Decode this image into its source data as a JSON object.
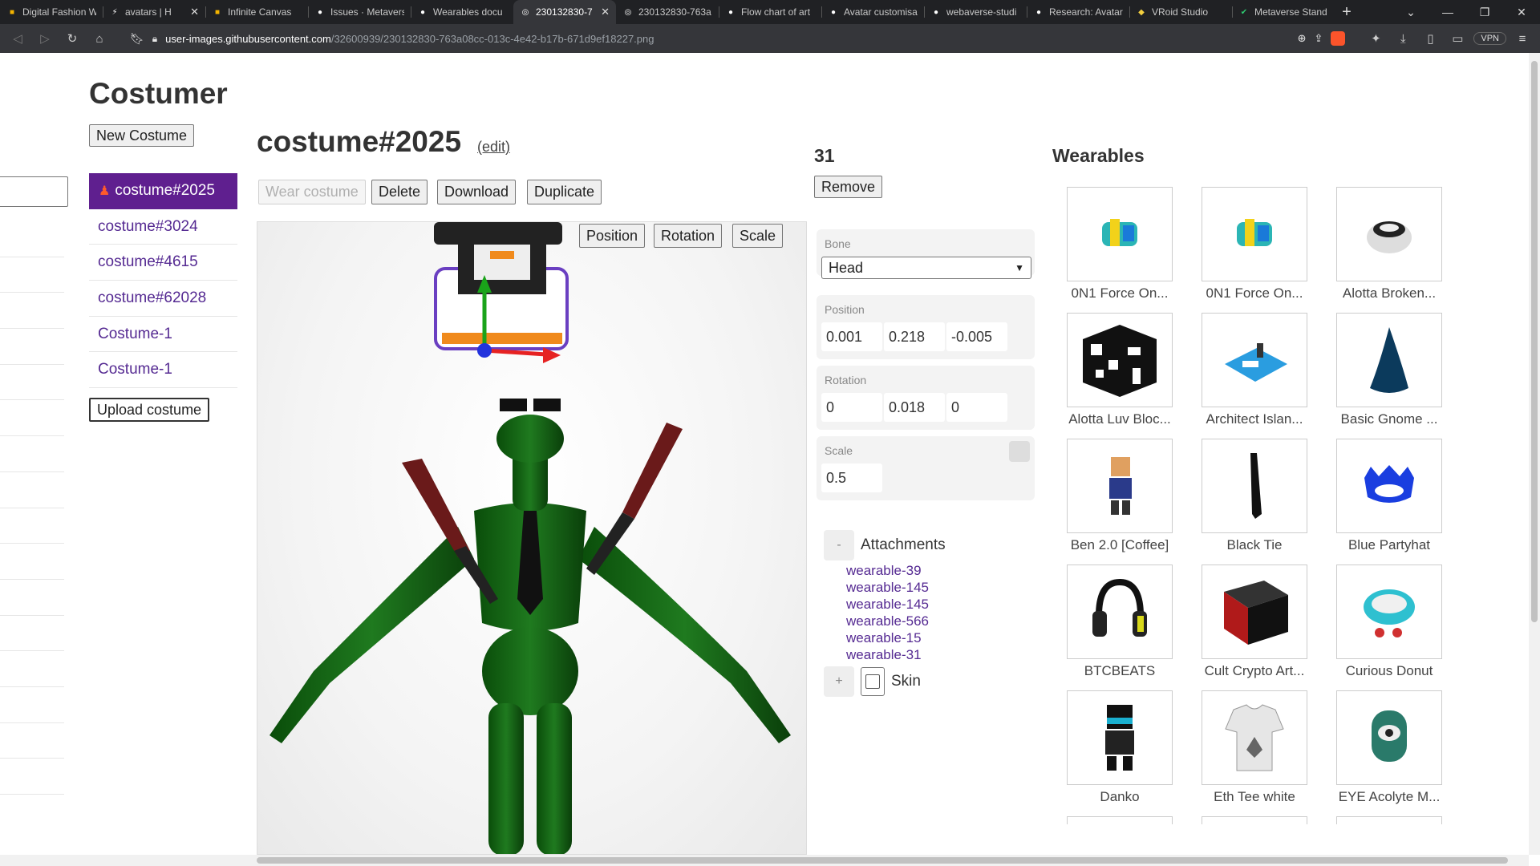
{
  "browser": {
    "tabs": [
      {
        "title": "Digital Fashion W",
        "icon": "page-icon",
        "color": "#f4b400",
        "active": false
      },
      {
        "title": "avatars | H",
        "icon": "audio-icon",
        "color": "#ffffff",
        "active": false
      },
      {
        "title": "Infinite Canvas",
        "icon": "page-icon",
        "color": "#f4b400",
        "active": false
      },
      {
        "title": "Issues · Metavers",
        "icon": "github-icon",
        "color": "#ffffff",
        "active": false
      },
      {
        "title": "Wearables docu",
        "icon": "github-icon",
        "color": "#ffffff",
        "active": false
      },
      {
        "title": "230132830-7",
        "icon": "globe-icon",
        "color": "#ffffff",
        "active": true
      },
      {
        "title": "230132830-763a",
        "icon": "globe-icon",
        "color": "#ffffff",
        "active": false
      },
      {
        "title": "Flow chart of art",
        "icon": "github-icon",
        "color": "#ffffff",
        "active": false
      },
      {
        "title": "Avatar customisa",
        "icon": "github-icon",
        "color": "#ffffff",
        "active": false
      },
      {
        "title": "webaverse-studi",
        "icon": "github-icon",
        "color": "#ffffff",
        "active": false
      },
      {
        "title": "Research: Avatar",
        "icon": "github-icon",
        "color": "#ffffff",
        "active": false
      },
      {
        "title": "VRoid Studio",
        "icon": "vroid-icon",
        "color": "#f4d03f",
        "active": false
      },
      {
        "title": "Metaverse Stand",
        "icon": "check-icon",
        "color": "#2ecc71",
        "active": false
      }
    ],
    "url_host": "user-images.githubusercontent.com",
    "url_path": "/32600939/230132830-763a08cc-013c-4e42-b17b-671d9ef18227.png",
    "vpn_label": "VPN"
  },
  "app": {
    "title": "Costumer",
    "new_costume_label": "New Costume",
    "upload_costume_label": "Upload costume",
    "costumes": [
      {
        "name": "costume#2025",
        "active": true
      },
      {
        "name": "costume#3024",
        "active": false
      },
      {
        "name": "costume#4615",
        "active": false
      },
      {
        "name": "costume#62028",
        "active": false
      },
      {
        "name": "Costume-1",
        "active": false
      },
      {
        "name": "Costume-1",
        "active": false
      }
    ]
  },
  "editor": {
    "costume_name": "costume#2025",
    "edit_label": "(edit)",
    "wear_label": "Wear costume",
    "delete_label": "Delete",
    "download_label": "Download",
    "duplicate_label": "Duplicate",
    "gizmo_modes": [
      "Position",
      "Rotation",
      "Scale"
    ]
  },
  "inspector": {
    "selected_id": "31",
    "remove_label": "Remove",
    "bone_label": "Bone",
    "bone_value": "Head",
    "position_label": "Position",
    "position": [
      "0.001",
      "0.218",
      "-0.005"
    ],
    "rotation_label": "Rotation",
    "rotation": [
      "0",
      "0.018",
      "0"
    ],
    "scale_label": "Scale",
    "scale": [
      "0.5"
    ],
    "attachments_toggle": "-",
    "attachments_label": "Attachments",
    "attachments": [
      "wearable-39",
      "wearable-145",
      "wearable-145",
      "wearable-566",
      "wearable-15",
      "wearable-31"
    ],
    "add_label": "+",
    "skin_label": "Skin"
  },
  "wearables": {
    "title": "Wearables",
    "items": [
      {
        "label": "0N1 Force On...",
        "icon": "sneaker-icon"
      },
      {
        "label": "0N1 Force On...",
        "icon": "sneaker-icon"
      },
      {
        "label": "Alotta Broken...",
        "icon": "bowl-icon"
      },
      {
        "label": "Alotta Luv Bloc...",
        "icon": "qr-cube-icon"
      },
      {
        "label": "Architect Islan...",
        "icon": "island-icon"
      },
      {
        "label": "Basic Gnome ...",
        "icon": "gnome-hat-icon"
      },
      {
        "label": "Ben 2.0 [Coffee]",
        "icon": "character-icon"
      },
      {
        "label": "Black Tie",
        "icon": "tie-icon"
      },
      {
        "label": "Blue Partyhat",
        "icon": "partyhat-icon"
      },
      {
        "label": "BTCBEATS",
        "icon": "headphones-icon"
      },
      {
        "label": "Cult Crypto Art...",
        "icon": "box-icon"
      },
      {
        "label": "Curious Donut",
        "icon": "donut-icon"
      },
      {
        "label": "Danko",
        "icon": "ninja-icon"
      },
      {
        "label": "Eth Tee white",
        "icon": "tshirt-icon"
      },
      {
        "label": "EYE Acolyte M...",
        "icon": "mask-icon"
      }
    ]
  }
}
